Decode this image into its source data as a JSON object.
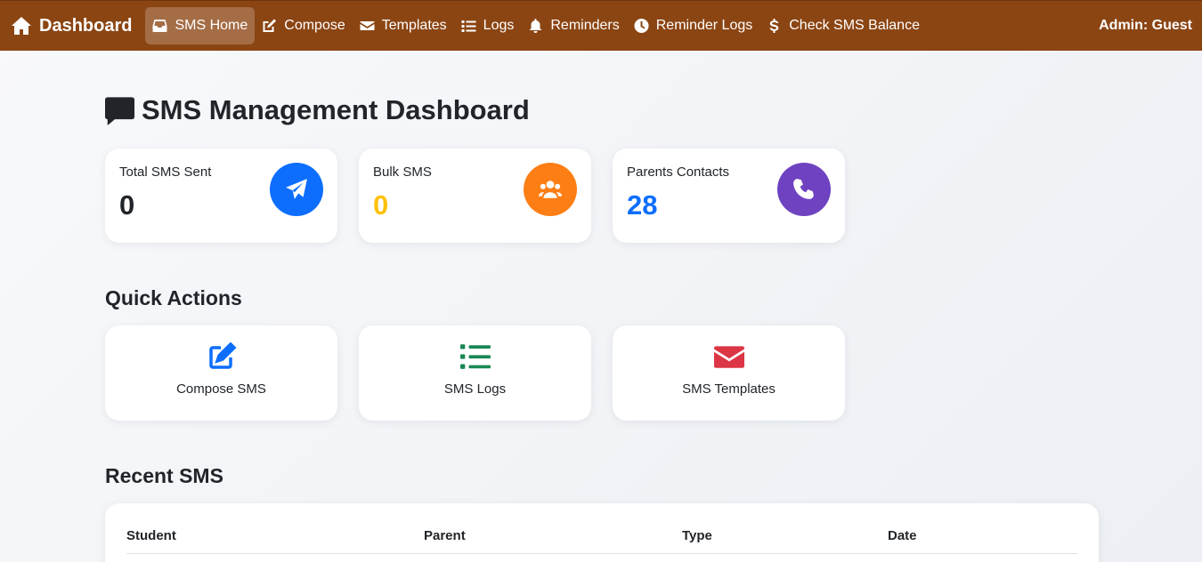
{
  "navbar": {
    "brand": "Dashboard",
    "items": [
      {
        "label": "SMS Home",
        "icon": "inbox-icon",
        "active": true
      },
      {
        "label": "Compose",
        "icon": "edit-icon"
      },
      {
        "label": "Templates",
        "icon": "envelope-icon"
      },
      {
        "label": "Logs",
        "icon": "list-icon"
      },
      {
        "label": "Reminders",
        "icon": "bell-icon"
      },
      {
        "label": "Reminder Logs",
        "icon": "clock-icon"
      },
      {
        "label": "Check SMS Balance",
        "icon": "dollar-icon"
      }
    ],
    "admin": "Admin: Guest",
    "color": "#8b4513"
  },
  "page": {
    "title": "SMS Management Dashboard",
    "title_icon": "comment-icon"
  },
  "stats": [
    {
      "label": "Total SMS Sent",
      "value": "0",
      "value_color": "#212529",
      "icon": "paper-plane-icon",
      "icon_bg": "#0d6efd"
    },
    {
      "label": "Bulk SMS",
      "value": "0",
      "value_color": "#ffc107",
      "icon": "users-icon",
      "icon_bg": "#fd7e14"
    },
    {
      "label": "Parents Contacts",
      "value": "28",
      "value_color": "#0d6efd",
      "icon": "phone-icon",
      "icon_bg": "#6f42c1"
    }
  ],
  "quick_actions": {
    "heading": "Quick Actions",
    "items": [
      {
        "label": "Compose SMS",
        "icon": "edit-icon",
        "color": "#0d6efd"
      },
      {
        "label": "SMS Logs",
        "icon": "list-icon",
        "color": "#198754"
      },
      {
        "label": "SMS Templates",
        "icon": "envelope-icon",
        "color": "#dc3545"
      }
    ]
  },
  "recent_sms": {
    "heading": "Recent SMS",
    "columns": [
      "Student",
      "Parent",
      "Type",
      "Date"
    ]
  }
}
